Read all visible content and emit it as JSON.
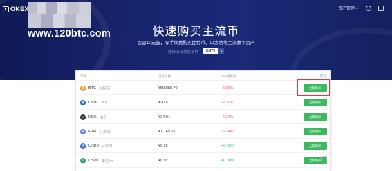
{
  "header": {
    "logo_text": "OKEX",
    "watermark": "www.120btc.com",
    "menu_user": "资产管理",
    "icons": [
      "user-icon",
      "download-icon"
    ]
  },
  "hero": {
    "title": "快速购买主流币",
    "subtitle": "仅需10元起，零手续费购买比特币、以太坊等主流数字资产",
    "currency_label": "选择法币交易币种",
    "currency_value": "CNY¥"
  },
  "table": {
    "headers": {
      "coin": "币种",
      "price": "当前价格",
      "change": "24H涨跌幅",
      "action": "操作"
    },
    "buy_label": "立即购买",
    "rows": [
      {
        "symbol": "BTC",
        "name": "比特币",
        "price": "¥59,888.70",
        "change": "-5.56%",
        "direction": "down",
        "icon_color": "#f7931a",
        "icon_glyph": "₿"
      },
      {
        "symbol": "OKB",
        "name": "OKB",
        "price": "¥20.57",
        "change": "-2.30%",
        "direction": "down",
        "icon_color": "#2d60e0",
        "icon_glyph": "◆"
      },
      {
        "symbol": "EOS",
        "name": "柚子",
        "price": "¥24.94",
        "change": "-6.37%",
        "direction": "down",
        "icon_color": "#333333",
        "icon_glyph": "◇"
      },
      {
        "symbol": "ETH",
        "name": "以太坊",
        "price": "¥1,145.15",
        "change": "-5.74%",
        "direction": "down",
        "icon_color": "#627eea",
        "icon_glyph": "♦"
      },
      {
        "symbol": "USDK",
        "name": "USDK",
        "price": "¥6.92",
        "change": "+0.00%",
        "direction": "up",
        "icon_color": "#3a6fe0",
        "icon_glyph": "K"
      },
      {
        "symbol": "USDT",
        "name": "泰达币",
        "price": "¥6.92",
        "change": "+0.00%",
        "direction": "up",
        "icon_color": "#26a17b",
        "icon_glyph": "T"
      }
    ]
  },
  "colors": {
    "hero_bg": "#16236b",
    "buy_button": "#3cb95f",
    "negative": "#e04f4f",
    "positive": "#2bb673",
    "highlight_box": "#e23b3b"
  }
}
